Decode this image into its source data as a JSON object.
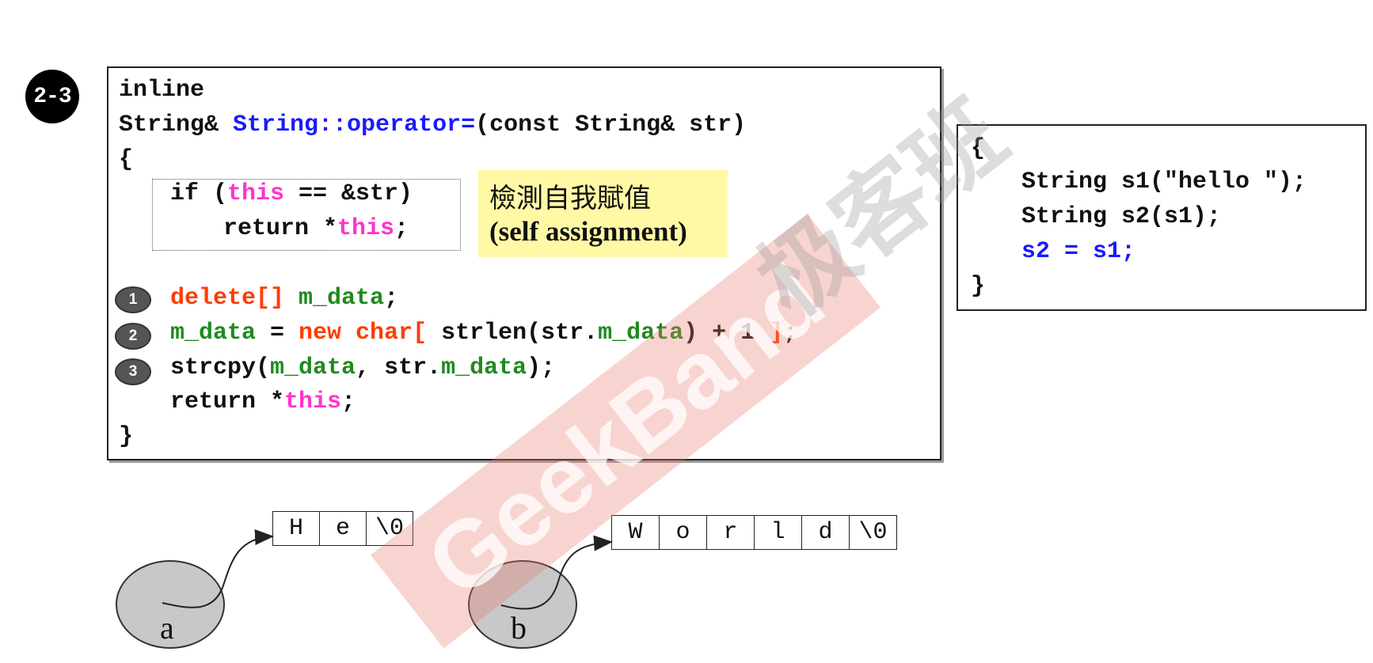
{
  "badge": "2-3",
  "code": {
    "line1": "inline",
    "line2_a": "String& ",
    "line2_b": "String::operator=",
    "line2_c": "(const String& str)",
    "brace_open": "{",
    "if_a": "if (",
    "if_this": "this",
    "if_b": " == &str)",
    "ret_a": "return *",
    "ret_this": "this",
    "ret_b": ";",
    "del_a": "delete[]",
    "del_b": " ",
    "del_c": "m_data",
    "del_d": ";",
    "new_a": "m_data",
    "new_b": " = ",
    "new_c": "new char[",
    "new_d": " strlen(str.",
    "new_e": "m_data",
    "new_f": ") + 1 ",
    "new_g": "]",
    "new_h": ";",
    "cpy_a": "strcpy(",
    "cpy_b": "m_data",
    "cpy_c": ", str.",
    "cpy_d": "m_data",
    "cpy_e": ");",
    "ret2_a": "return *",
    "ret2_this": "this",
    "ret2_b": ";",
    "brace_close": "}"
  },
  "note": {
    "zh": "檢測自我賦值",
    "en": "(self assignment)"
  },
  "steps": [
    "1",
    "2",
    "3"
  ],
  "usage": {
    "open": "{",
    "l1": "String s1(\"hello \");",
    "l2": "String s2(s1);",
    "l3": "s2 = s1;",
    "close": "}"
  },
  "memory": {
    "a_cells": [
      "H",
      "e",
      "\\0"
    ],
    "b_cells": [
      "W",
      "o",
      "r",
      "l",
      "d",
      "\\0"
    ],
    "a_label": "a",
    "b_label": "b"
  },
  "watermark": {
    "text": "GeekBand",
    "cn": "极客班"
  },
  "colors": {
    "this": "#ff33cc",
    "operator": "#1a1aff",
    "member": "#1f8a1f",
    "keyword": "#ff3b00"
  }
}
